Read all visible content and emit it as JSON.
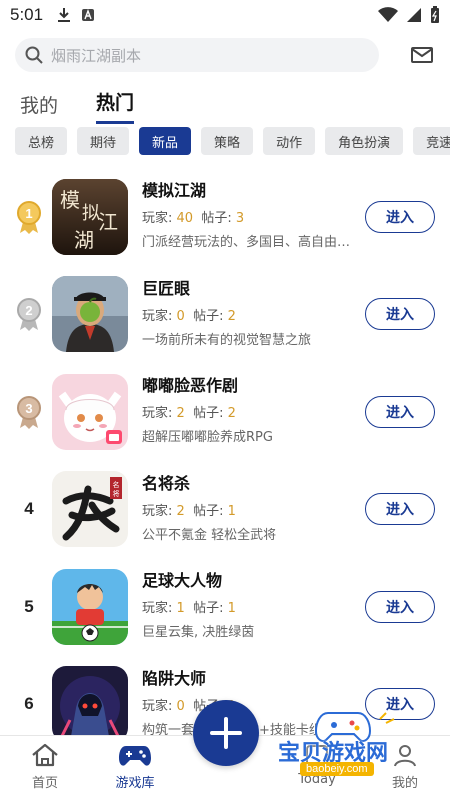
{
  "status_bar": {
    "time": "5:01"
  },
  "search": {
    "placeholder": "烟雨江湖副本"
  },
  "tabs": [
    {
      "label": "我的"
    },
    {
      "label": "热门"
    }
  ],
  "categories": [
    "总榜",
    "期待",
    "新品",
    "策略",
    "动作",
    "角色扮演",
    "竞速"
  ],
  "stat_labels": {
    "players": "玩家: ",
    "posts": "帖子: "
  },
  "enter_label": "进入",
  "games": [
    {
      "rank": "1",
      "name": "模拟江湖",
      "players": "40",
      "posts": "3",
      "desc": "门派经营玩法的、多国目、高自由…"
    },
    {
      "rank": "2",
      "name": "巨匠眼",
      "players": "0",
      "posts": "2",
      "desc": "一场前所未有的视觉智慧之旅"
    },
    {
      "rank": "3",
      "name": "嘟嘟脸恶作剧",
      "players": "2",
      "posts": "2",
      "desc": "超解压嘟嘟脸养成RPG"
    },
    {
      "rank": "4",
      "name": "名将杀",
      "players": "2",
      "posts": "1",
      "desc": "公平不氪金 轻松全武将"
    },
    {
      "rank": "5",
      "name": "足球大人物",
      "players": "1",
      "posts": "1",
      "desc": "巨星云集, 决胜绿茵"
    },
    {
      "rank": "6",
      "name": "陷阱大师",
      "players": "0",
      "posts": "1",
      "desc": "构筑一套独特的陷阱+技能卡组"
    }
  ],
  "bottom_nav": [
    {
      "label": "首页"
    },
    {
      "label": "游戏库"
    },
    {
      "label": "Today"
    },
    {
      "label": "我的"
    }
  ],
  "watermark": {
    "text": "宝贝游戏网",
    "url": "baobeiy.com"
  },
  "colors": {
    "accent": "#1a3a93",
    "number": "#d39a2a",
    "chip_bg": "#e9eaec"
  }
}
